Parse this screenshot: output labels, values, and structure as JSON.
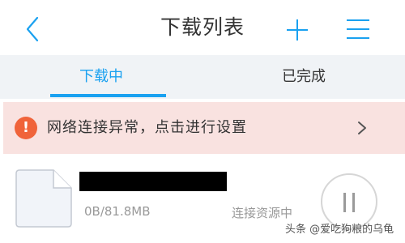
{
  "header": {
    "title": "下载列表",
    "back_icon": "chevron-left-icon",
    "add_icon": "plus-icon",
    "menu_icon": "hamburger-menu-icon"
  },
  "tabs": [
    {
      "label": "下载中",
      "active": true
    },
    {
      "label": "已完成",
      "active": false
    }
  ],
  "alert": {
    "icon_symbol": "!",
    "text": "网络连接异常，点击进行设置"
  },
  "download_item": {
    "size_progress": "0B/81.8MB",
    "status": "连接资源中",
    "action": "pause"
  },
  "watermark": "头条 @爱吃狗粮的乌龟",
  "colors": {
    "accent": "#1aa1f0",
    "tab_bar_bg": "#f0f3f6",
    "alert_bg": "#f9e2e0",
    "alert_icon": "#f0633a"
  }
}
